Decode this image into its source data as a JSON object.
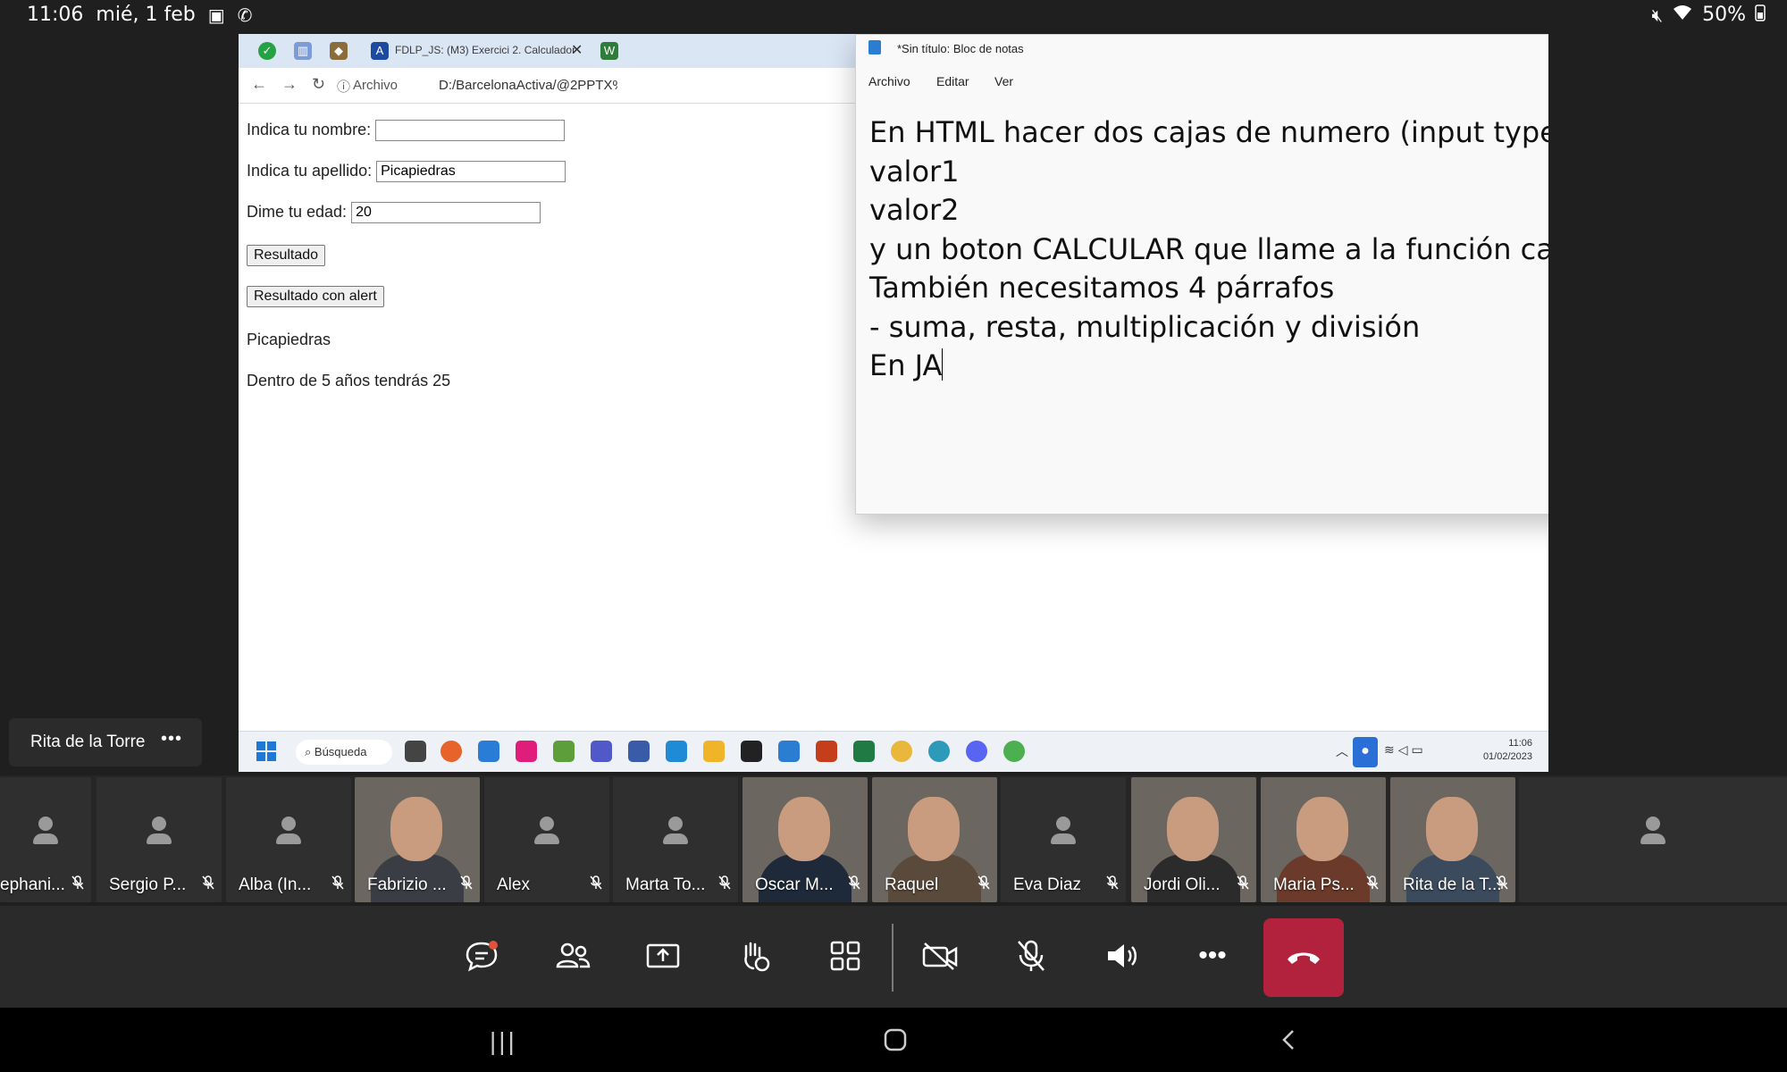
{
  "status_bar": {
    "time": "11:06",
    "date": "mié, 1 feb",
    "battery": "50%",
    "icons": [
      "image-icon",
      "phone-icon",
      "mute-icon",
      "wifi-icon",
      "battery-icon"
    ]
  },
  "browser": {
    "tab_title": "FDLP_JS: (M3) Exercici 2. Calculador",
    "address_prefix": "Archivo",
    "address_url": "D:/BarcelonaActiva/@2PPTX%"
  },
  "form": {
    "name_label": "Indica tu nombre:",
    "name_value": "",
    "surname_label": "Indica tu apellido:",
    "surname_value": "Picapiedras",
    "age_label": "Dime tu edad:",
    "age_value": "20",
    "result_button": "Resultado",
    "result_alert_button": "Resultado con alert",
    "output_surname": "Picapiedras",
    "output_age": "Dentro de 5 años tendrás 25"
  },
  "notepad": {
    "title": "*Sin título: Bloc de notas",
    "menu": [
      "Archivo",
      "Editar",
      "Ver"
    ],
    "lines": [
      "En HTML hacer dos cajas de numero (input type=\"number\")",
      "valor1",
      "valor2",
      "y un boton CALCULAR que llame a la función calcular()",
      "También necesitamos 4 párrafos",
      "- suma, resta, multiplicación y división",
      "",
      "En JA"
    ]
  },
  "taskbar": {
    "search_label": "Búsqueda",
    "time": "11:06",
    "date": "01/02/2023"
  },
  "presenter": {
    "name": "Rita de la Torre",
    "more": "•••"
  },
  "participants": [
    {
      "name": "ephani...",
      "video": false
    },
    {
      "name": "Sergio P...",
      "video": false
    },
    {
      "name": "Alba  (In...",
      "video": false
    },
    {
      "name": "Fabrizio ...",
      "video": true
    },
    {
      "name": "Alex",
      "video": false
    },
    {
      "name": "Marta To...",
      "video": false
    },
    {
      "name": "Oscar M...",
      "video": true
    },
    {
      "name": "Raquel",
      "video": true
    },
    {
      "name": "Eva Diaz",
      "video": false
    },
    {
      "name": "Jordi Oli...",
      "video": true
    },
    {
      "name": "Maria Ps...",
      "video": true
    },
    {
      "name": "Rita de la T...",
      "video": true
    },
    {
      "name": "",
      "video": false
    }
  ],
  "controls": [
    "chat-icon",
    "people-icon",
    "share-screen-icon",
    "raise-hand-icon",
    "grid-view-icon",
    "camera-off-icon",
    "mic-off-icon",
    "speaker-icon",
    "more-icon",
    "hang-up-icon"
  ],
  "colors": {
    "hangup": "#b3223c",
    "accent": "#2a6fd6"
  }
}
